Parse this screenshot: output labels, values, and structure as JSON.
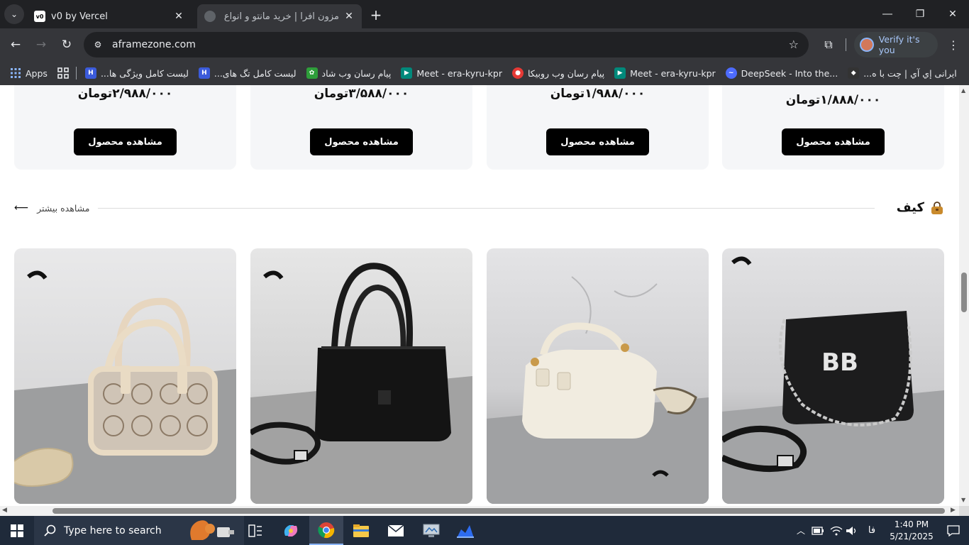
{
  "browser": {
    "tabs": [
      {
        "title": "v0 by Vercel",
        "favicon": "v0-icon",
        "fav_text": "v0",
        "active": false
      },
      {
        "title": "مزون افرا | خرید مانتو و انواع لباس",
        "favicon": "globe-icon",
        "active": true
      }
    ],
    "url": "aframezone.com",
    "verify_label": "Verify it's you",
    "bookmarks": [
      {
        "label": "Apps",
        "icon": "apps-grid-icon"
      },
      {
        "label": "لیست کامل ویژگی ها...",
        "icon": "h-logo-icon",
        "color": "#3b5bdb"
      },
      {
        "label": "لیست کامل تگ های...",
        "icon": "h-logo-icon",
        "color": "#3b5bdb"
      },
      {
        "label": "پیام رسان وب شاد",
        "icon": "shad-icon",
        "color": "#2e9e3a"
      },
      {
        "label": "Meet - era-kyru-kpr",
        "icon": "meet-icon",
        "color": "#00897b"
      },
      {
        "label": "پیام رسان وب روبیکا",
        "icon": "rubika-icon",
        "color": "#e53935"
      },
      {
        "label": "Meet - era-kyru-kpr",
        "icon": "meet-icon",
        "color": "#00897b"
      },
      {
        "label": "DeepSeek - Into the...",
        "icon": "deepseek-icon",
        "color": "#4d6bfe"
      },
      {
        "label": "ایرانی إي آي | چت با ه...",
        "icon": "ai-icon",
        "color": "#333"
      }
    ]
  },
  "page": {
    "price_cards": [
      {
        "price": "۲/۹۸۸/۰۰۰تومان",
        "button": "مشاهده محصول"
      },
      {
        "price": "۳/۵۸۸/۰۰۰تومان",
        "button": "مشاهده محصول"
      },
      {
        "price": "۱/۹۸۸/۰۰۰تومان",
        "button": "مشاهده محصول"
      },
      {
        "price": "۱/۸۸۸/۰۰۰تومان",
        "button": "مشاهده محصول"
      }
    ],
    "section": {
      "title": "کیف",
      "see_more": "مشاهده بیشتر"
    },
    "products": [
      {
        "name": "beige-monogram-handbag"
      },
      {
        "name": "black-leather-handbag"
      },
      {
        "name": "cream-barrel-handbag"
      },
      {
        "name": "black-chain-shoulder-bag"
      }
    ]
  },
  "taskbar": {
    "search_placeholder": "Type here to search",
    "lang": "فا",
    "time": "1:40 PM",
    "date": "5/21/2025"
  },
  "colors": {
    "accent": "#8ab4f8",
    "button_bg": "#000000",
    "card_bg": "#f5f6f8"
  }
}
